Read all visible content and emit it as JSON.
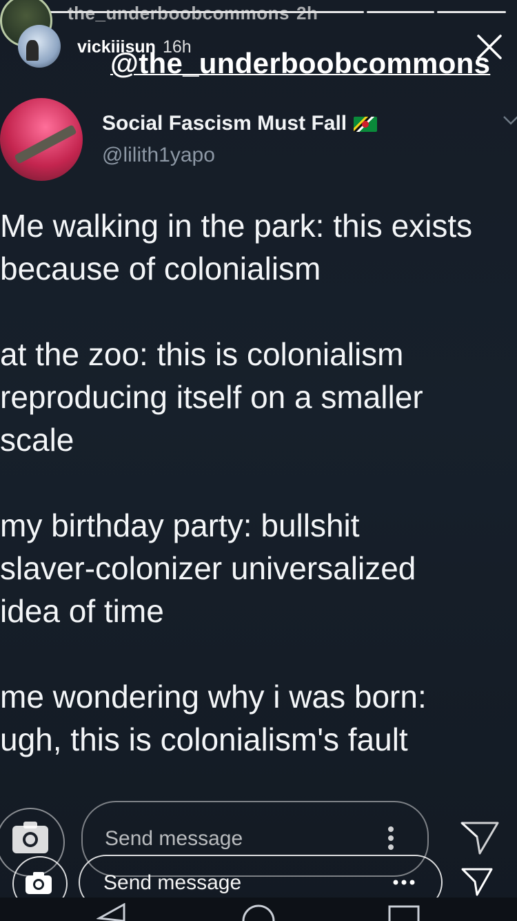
{
  "story_header": {
    "ghost_username": "the_underboobcommons",
    "ghost_time": "2h",
    "username": "vickiiisun",
    "time": "16h",
    "overlay_handle": "@the_underboobcommons"
  },
  "tweet": {
    "display_name": "Social Fascism Must Fall",
    "handle": "@lilith1yapo",
    "paragraphs": [
      "Me walking in the park: this exists\nbecause of colonialism",
      "at the zoo: this is colonialism\nreproducing itself on a smaller\nscale",
      "my birthday party: bullshit\nslaver-colonizer universalized\nidea of time",
      "me wondering why i was born:\nugh, this is colonialism's fault"
    ]
  },
  "composer": {
    "placeholder_top": "Send message",
    "placeholder_bottom": "Send message"
  },
  "icons": {
    "close": "close-icon",
    "camera": "camera-icon",
    "send": "send-icon",
    "more": "more-icon",
    "chevron": "chevron-down-icon",
    "flag": "dominica-flag-icon"
  }
}
